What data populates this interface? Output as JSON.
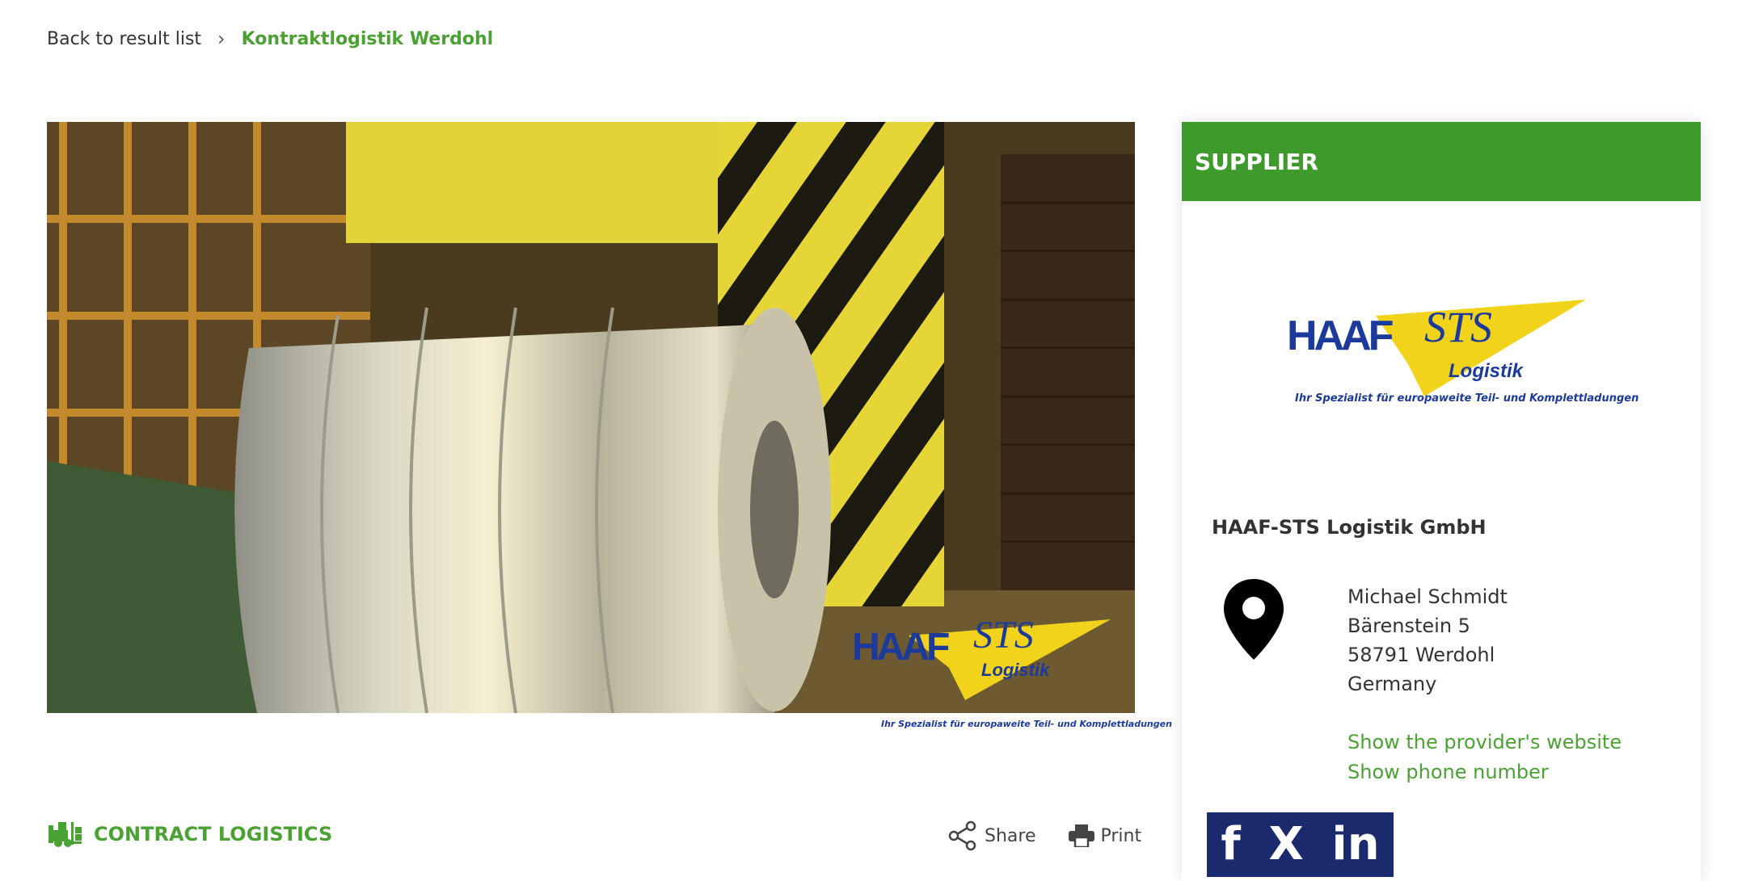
{
  "breadcrumb": {
    "back_label": "Back to result list",
    "current_label": "Kontraktlogistik Werdohl"
  },
  "hero": {
    "logo_caption": "Ihr Spezialist für europaweite Teil- und Komplettladungen"
  },
  "supplier": {
    "heading": "SUPPLIER",
    "logo_caption": "Ihr Spezialist für europaweite Teil- und Komplettladungen",
    "company": "HAAF-STS Logistik GmbH",
    "address": {
      "name": "Michael Schmidt",
      "street": "Bärenstein 5",
      "city": "58791 Werdohl",
      "country": "Germany"
    },
    "links": {
      "website": "Show the provider's website",
      "phone": "Show phone number"
    },
    "social": {
      "facebook": "f",
      "x": "X",
      "linkedin": "in"
    }
  },
  "category": {
    "label": "CONTRACT LOGISTICS",
    "icon": "forklift-icon"
  },
  "actions": {
    "share_label": "Share",
    "print_label": "Print"
  },
  "colors": {
    "brand_green": "#4aa232",
    "header_green": "#3e9a2a",
    "logo_blue": "#1c3a9a",
    "logo_yellow": "#f2d31b"
  }
}
